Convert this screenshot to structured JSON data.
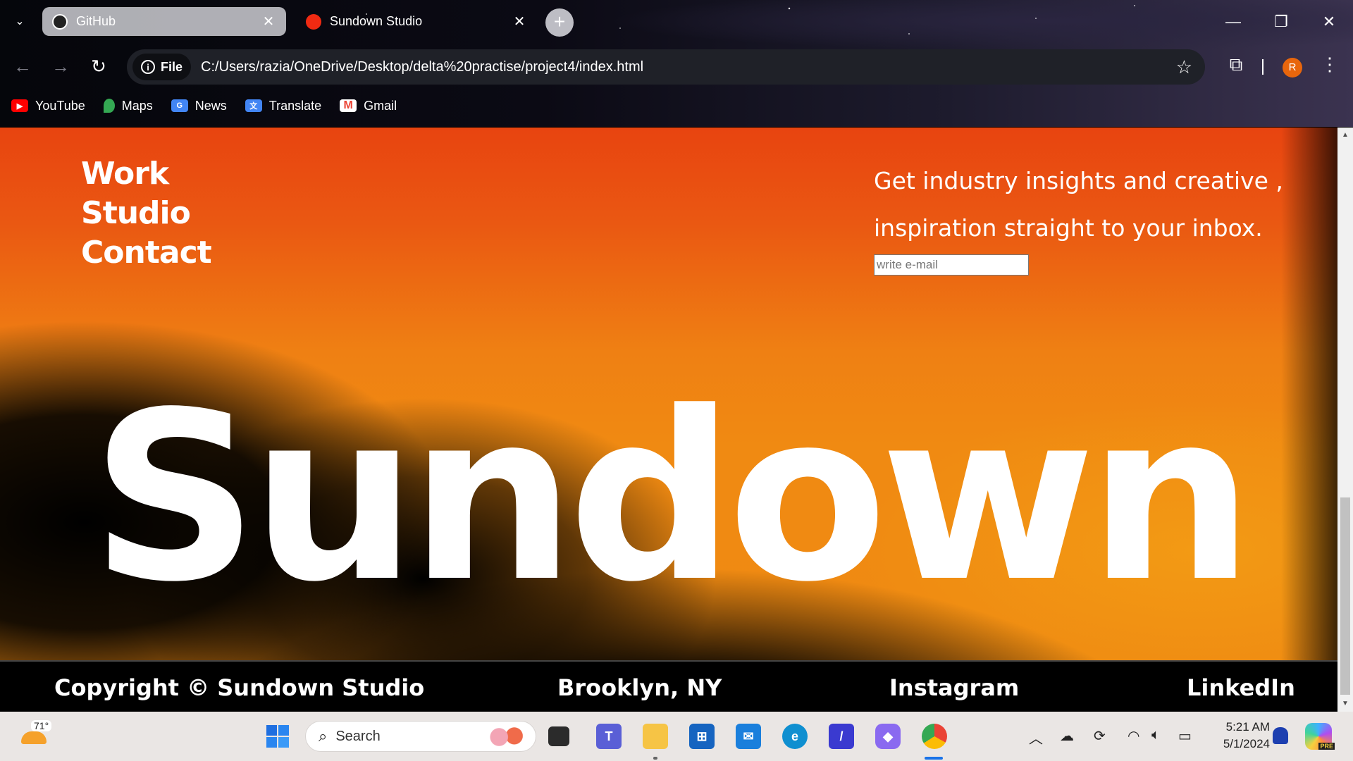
{
  "browser": {
    "tabs": [
      {
        "title": "GitHub",
        "icon": "github-icon",
        "active": false
      },
      {
        "title": "Sundown Studio",
        "icon": "sundown-favicon",
        "active": true
      }
    ],
    "address": {
      "chip_label": "File",
      "url": "C:/Users/razia/OneDrive/Desktop/delta%20practise/project4/index.html"
    },
    "profile_initial": "R",
    "bookmarks": [
      {
        "label": "YouTube",
        "icon": "youtube-icon",
        "color": "#ff0000"
      },
      {
        "label": "Maps",
        "icon": "maps-icon",
        "color": "#34a853"
      },
      {
        "label": "News",
        "icon": "news-icon",
        "color": "#4285f4"
      },
      {
        "label": "Translate",
        "icon": "translate-icon",
        "color": "#4285f4"
      },
      {
        "label": "Gmail",
        "icon": "gmail-icon",
        "color": "#ea4335"
      }
    ]
  },
  "page": {
    "nav": [
      "Work",
      "Studio",
      "Contact"
    ],
    "newsletter": {
      "line1": "Get industry insights and creative ,",
      "line2": "inspiration straight to your inbox.",
      "placeholder": "write e-mail"
    },
    "hero": "Sundown",
    "footer": {
      "copyright": "Copyright © Sundown Studio",
      "location": "Brooklyn, NY",
      "instagram": "Instagram",
      "linkedin": "LinkedIn"
    },
    "colors": {
      "orange_top": "#e84410",
      "orange_mid": "#f08a12",
      "dark": "#000000"
    }
  },
  "taskbar": {
    "weather_temp": "71°",
    "search_label": "Search",
    "time": "5:21 AM",
    "date": "5/1/2024",
    "copilot_badge": "PRE"
  }
}
